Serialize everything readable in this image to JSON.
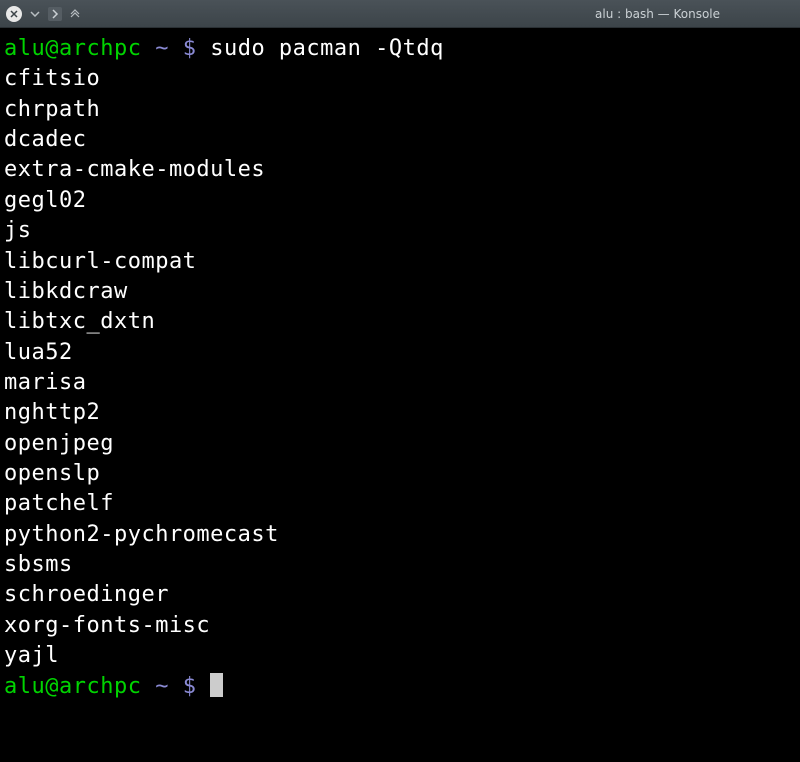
{
  "window": {
    "title": "alu : bash — Konsole"
  },
  "prompt": {
    "user_host": "alu@archpc",
    "path": "~",
    "symbol": "$"
  },
  "commands": [
    {
      "text": "sudo pacman -Qtdq"
    }
  ],
  "output": [
    "cfitsio",
    "chrpath",
    "dcadec",
    "extra-cmake-modules",
    "gegl02",
    "js",
    "libcurl-compat",
    "libkdcraw",
    "libtxc_dxtn",
    "lua52",
    "marisa",
    "nghttp2",
    "openjpeg",
    "openslp",
    "patchelf",
    "python2-pychromecast",
    "sbsms",
    "schroedinger",
    "xorg-fonts-misc",
    "yajl"
  ]
}
